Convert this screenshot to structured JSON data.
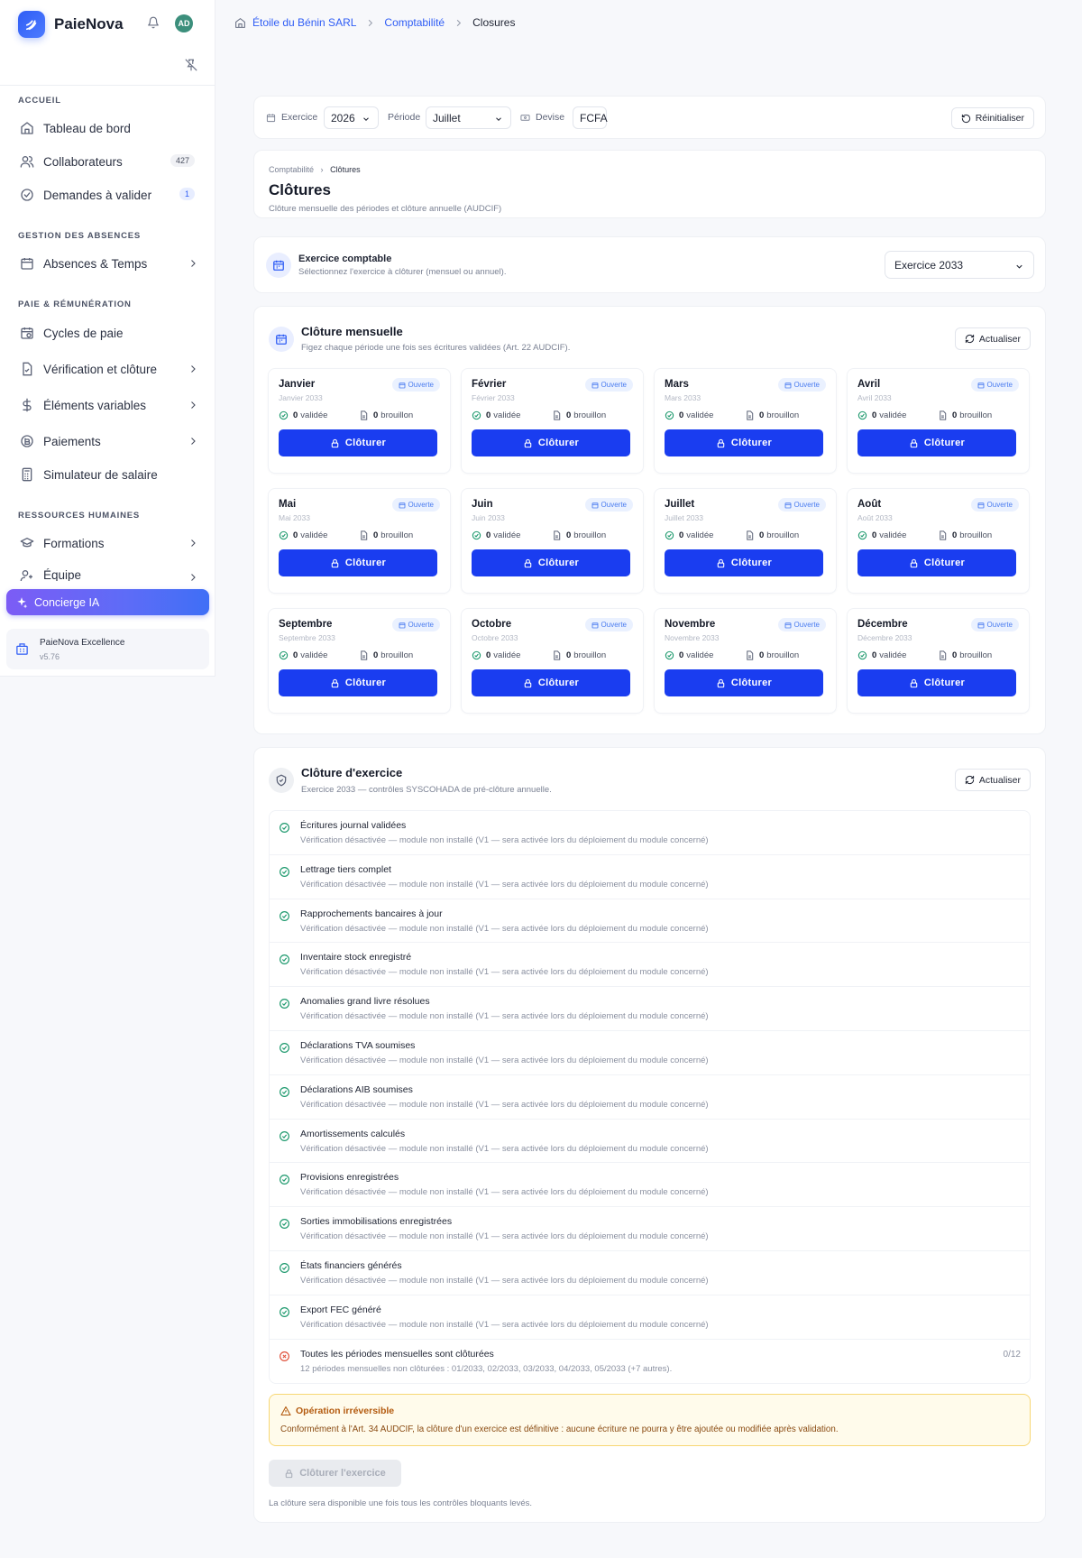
{
  "app": {
    "name": "PaieNova",
    "avatar_initials": "AD"
  },
  "sidebar": {
    "sections": [
      {
        "title": "ACCUEIL"
      },
      {
        "title": "GESTION DES ABSENCES"
      },
      {
        "title": "PAIE & RÉMUNÉRATION"
      },
      {
        "title": "RESSOURCES HUMAINES"
      }
    ],
    "items": [
      {
        "label": "Tableau de bord",
        "icon": "home-icon"
      },
      {
        "label": "Collaborateurs",
        "icon": "users-icon",
        "badge": "427"
      },
      {
        "label": "Demandes à valider",
        "icon": "check-circle-icon",
        "badge": "1"
      },
      {
        "label": "Absences & Temps",
        "icon": "calendar-icon"
      },
      {
        "label": "Cycles de paie",
        "icon": "calendar-clock-icon"
      },
      {
        "label": "Vérification et clôture",
        "icon": "file-check-icon"
      },
      {
        "label": "Éléments variables",
        "icon": "dollar-icon"
      },
      {
        "label": "Paiements",
        "icon": "coin-icon"
      },
      {
        "label": "Simulateur de salaire",
        "icon": "calculator-icon"
      },
      {
        "label": "Formations",
        "icon": "graduation-cap-icon"
      },
      {
        "label": "Équipe",
        "icon": "user-plus-icon"
      }
    ],
    "concierge": "Concierge IA",
    "plan": {
      "name": "PaieNova Excellence",
      "version": "v5.76"
    }
  },
  "breadcrumb": {
    "company": "Étoile du Bénin SARL",
    "section": "Comptabilité",
    "current": "Closures"
  },
  "filters": {
    "exercice_label": "Exercice",
    "exercice_value": "2026",
    "periode_label": "Période",
    "periode_value": "Juillet",
    "devise_label": "Devise",
    "devise_value": "FCFA",
    "reset": "Réinitialiser"
  },
  "header": {
    "crumb_parent": "Comptabilité",
    "crumb_current": "Clôtures",
    "title": "Clôtures",
    "subtitle": "Clôture mensuelle des périodes et clôture annuelle (AUDCIF)"
  },
  "exercise": {
    "title": "Exercice comptable",
    "subtitle": "Sélectionnez l'exercice à clôturer (mensuel ou annuel).",
    "selected": "Exercice 2033"
  },
  "monthly": {
    "title": "Clôture mensuelle",
    "subtitle": "Figez chaque période une fois ses écritures validées (Art. 22 AUDCIF).",
    "refresh": "Actualiser",
    "status_label": "Ouverte",
    "validated_label": "validée",
    "draft_label": "brouillon",
    "button_label": "Clôturer",
    "months": [
      {
        "name": "Janvier",
        "sub": "Janvier 2033",
        "validated": "0",
        "draft": "0"
      },
      {
        "name": "Février",
        "sub": "Février 2033",
        "validated": "0",
        "draft": "0"
      },
      {
        "name": "Mars",
        "sub": "Mars 2033",
        "validated": "0",
        "draft": "0"
      },
      {
        "name": "Avril",
        "sub": "Avril 2033",
        "validated": "0",
        "draft": "0"
      },
      {
        "name": "Mai",
        "sub": "Mai 2033",
        "validated": "0",
        "draft": "0"
      },
      {
        "name": "Juin",
        "sub": "Juin 2033",
        "validated": "0",
        "draft": "0"
      },
      {
        "name": "Juillet",
        "sub": "Juillet 2033",
        "validated": "0",
        "draft": "0"
      },
      {
        "name": "Août",
        "sub": "Août 2033",
        "validated": "0",
        "draft": "0"
      },
      {
        "name": "Septembre",
        "sub": "Septembre 2033",
        "validated": "0",
        "draft": "0"
      },
      {
        "name": "Octobre",
        "sub": "Octobre 2033",
        "validated": "0",
        "draft": "0"
      },
      {
        "name": "Novembre",
        "sub": "Novembre 2033",
        "validated": "0",
        "draft": "0"
      },
      {
        "name": "Décembre",
        "sub": "Décembre 2033",
        "validated": "0",
        "draft": "0"
      }
    ]
  },
  "annual": {
    "title": "Clôture d'exercice",
    "subtitle": "Exercice 2033 — contrôles SYSCOHADA de pré-clôture annuelle.",
    "refresh": "Actualiser",
    "checks": [
      {
        "title": "Écritures journal validées",
        "desc": "Vérification désactivée — module non installé (V1 — sera activée lors du déploiement du module concerné)",
        "status": "ok"
      },
      {
        "title": "Lettrage tiers complet",
        "desc": "Vérification désactivée — module non installé (V1 — sera activée lors du déploiement du module concerné)",
        "status": "ok"
      },
      {
        "title": "Rapprochements bancaires à jour",
        "desc": "Vérification désactivée — module non installé (V1 — sera activée lors du déploiement du module concerné)",
        "status": "ok"
      },
      {
        "title": "Inventaire stock enregistré",
        "desc": "Vérification désactivée — module non installé (V1 — sera activée lors du déploiement du module concerné)",
        "status": "ok"
      },
      {
        "title": "Anomalies grand livre résolues",
        "desc": "Vérification désactivée — module non installé (V1 — sera activée lors du déploiement du module concerné)",
        "status": "ok"
      },
      {
        "title": "Déclarations TVA soumises",
        "desc": "Vérification désactivée — module non installé (V1 — sera activée lors du déploiement du module concerné)",
        "status": "ok"
      },
      {
        "title": "Déclarations AIB soumises",
        "desc": "Vérification désactivée — module non installé (V1 — sera activée lors du déploiement du module concerné)",
        "status": "ok"
      },
      {
        "title": "Amortissements calculés",
        "desc": "Vérification désactivée — module non installé (V1 — sera activée lors du déploiement du module concerné)",
        "status": "ok"
      },
      {
        "title": "Provisions enregistrées",
        "desc": "Vérification désactivée — module non installé (V1 — sera activée lors du déploiement du module concerné)",
        "status": "ok"
      },
      {
        "title": "Sorties immobilisations enregistrées",
        "desc": "Vérification désactivée — module non installé (V1 — sera activée lors du déploiement du module concerné)",
        "status": "ok"
      },
      {
        "title": "États financiers générés",
        "desc": "Vérification désactivée — module non installé (V1 — sera activée lors du déploiement du module concerné)",
        "status": "ok"
      },
      {
        "title": "Export FEC généré",
        "desc": "Vérification désactivée — module non installé (V1 — sera activée lors du déploiement du module concerné)",
        "status": "ok"
      },
      {
        "title": "Toutes les périodes mensuelles sont clôturées",
        "desc": "12 périodes mensuelles non clôturées : 01/2033, 02/2033, 03/2033, 04/2033, 05/2033 (+7 autres).",
        "status": "fail",
        "count": "0/12"
      }
    ],
    "warning_title": "Opération irréversible",
    "warning_text": "Conformément à l'Art. 34 AUDCIF, la clôture d'un exercice est définitive : aucune écriture ne pourra y être ajoutée ou modifiée après validation.",
    "close_button": "Clôturer l'exercice",
    "close_note": "La clôture sera disponible une fois tous les contrôles bloquants levés."
  },
  "colors": {
    "primary": "#1a3df0",
    "ok": "#1f9a6e",
    "fail": "#e0533d",
    "warning_bg": "#fffbeb",
    "status_open": "#4a7cf0"
  }
}
